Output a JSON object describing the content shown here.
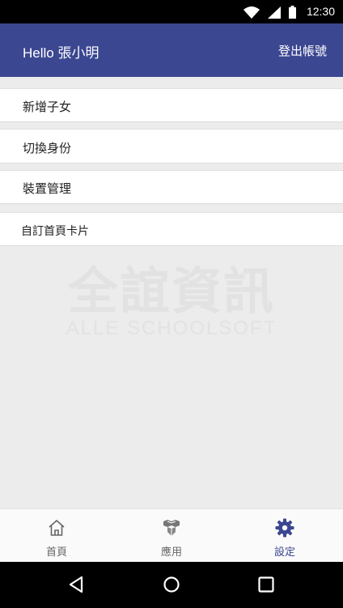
{
  "status_bar": {
    "time": "12:30",
    "icons": [
      "wifi-icon",
      "signal-icon",
      "battery-icon"
    ]
  },
  "header": {
    "greeting": "Hello 張小明",
    "logout_label": "登出帳號"
  },
  "menu": {
    "items": [
      {
        "label": "新增子女"
      },
      {
        "label": "切換身份"
      },
      {
        "label": "裝置管理"
      },
      {
        "label": "自訂首頁卡片"
      }
    ]
  },
  "watermark": {
    "chinese": "全誼資訊",
    "english": "ALLE SCHOOLSOFT"
  },
  "tabbar": {
    "tabs": [
      {
        "label": "首頁",
        "icon": "home-icon"
      },
      {
        "label": "應用",
        "icon": "apps-cubes-icon"
      },
      {
        "label": "設定",
        "icon": "gear-icon",
        "active": true
      }
    ]
  },
  "nav_bar": {
    "buttons": [
      "back-icon",
      "home-circle-icon",
      "recents-square-icon"
    ]
  },
  "colors": {
    "accent": "#3b4791",
    "background": "#ececec",
    "tab_inactive": "#666666"
  }
}
